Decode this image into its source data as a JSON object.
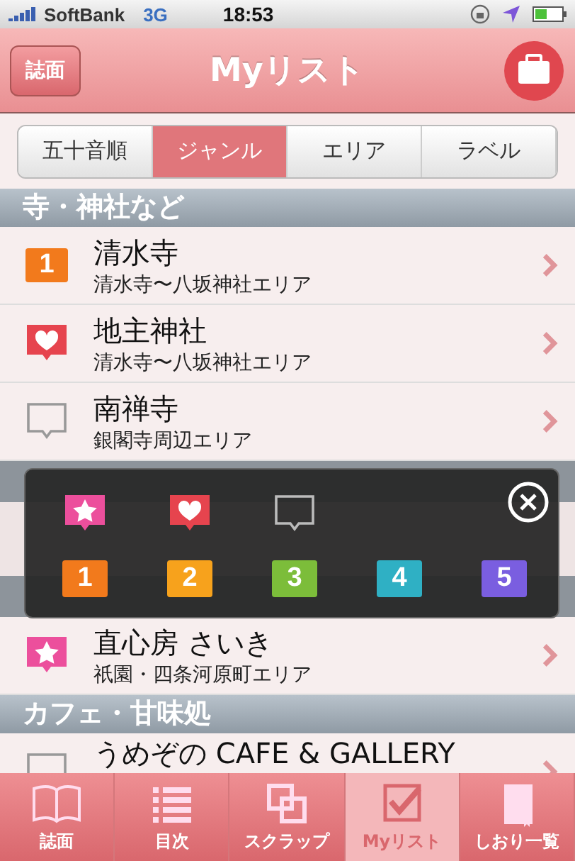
{
  "status_bar": {
    "carrier": "SoftBank",
    "network": "3G",
    "time": "18:53"
  },
  "nav": {
    "back": "誌面",
    "title": "Myリスト"
  },
  "segments": [
    {
      "label": "五十音順",
      "selected": false
    },
    {
      "label": "ジャンル",
      "selected": true
    },
    {
      "label": "エリア",
      "selected": false
    },
    {
      "label": "ラベル",
      "selected": false
    }
  ],
  "sections_before": [
    {
      "header": "寺・神社など",
      "rows": [
        {
          "name": "清水寺",
          "area": "清水寺〜八坂神社エリア",
          "marker": {
            "kind": "number",
            "label": "1",
            "color": "#f27a1c"
          }
        },
        {
          "name": "地主神社",
          "area": "清水寺〜八坂神社エリア",
          "marker": {
            "kind": "heart"
          }
        },
        {
          "name": "南禅寺",
          "area": "銀閣寺周辺エリア",
          "marker": {
            "kind": "empty"
          }
        }
      ]
    }
  ],
  "popup": {
    "options": [
      {
        "kind": "star"
      },
      {
        "kind": "heart"
      },
      {
        "kind": "empty"
      },
      {
        "kind": "number",
        "label": "1",
        "color": "#f27a1c"
      },
      {
        "kind": "number",
        "label": "2",
        "color": "#f7a21c"
      },
      {
        "kind": "number",
        "label": "3",
        "color": "#7cbd3a"
      },
      {
        "kind": "number",
        "label": "4",
        "color": "#2fb0c4"
      },
      {
        "kind": "number",
        "label": "5",
        "color": "#7a5ee0"
      }
    ]
  },
  "rows_after": [
    {
      "name": "直心房 さいき",
      "area": "祇園・四条河原町エリア",
      "marker": {
        "kind": "star"
      }
    }
  ],
  "sections_after": [
    {
      "header": "カフェ・甘味処",
      "rows": [
        {
          "name": "うめぞの CAFE & GALLERY",
          "marker": {
            "kind": "empty"
          }
        }
      ]
    }
  ],
  "tab_bar": [
    {
      "label": "誌面",
      "selected": false
    },
    {
      "label": "目次",
      "selected": false
    },
    {
      "label": "スクラップ",
      "selected": false
    },
    {
      "label": "Myリスト",
      "selected": true
    },
    {
      "label": "しおり一覧",
      "selected": false
    }
  ]
}
